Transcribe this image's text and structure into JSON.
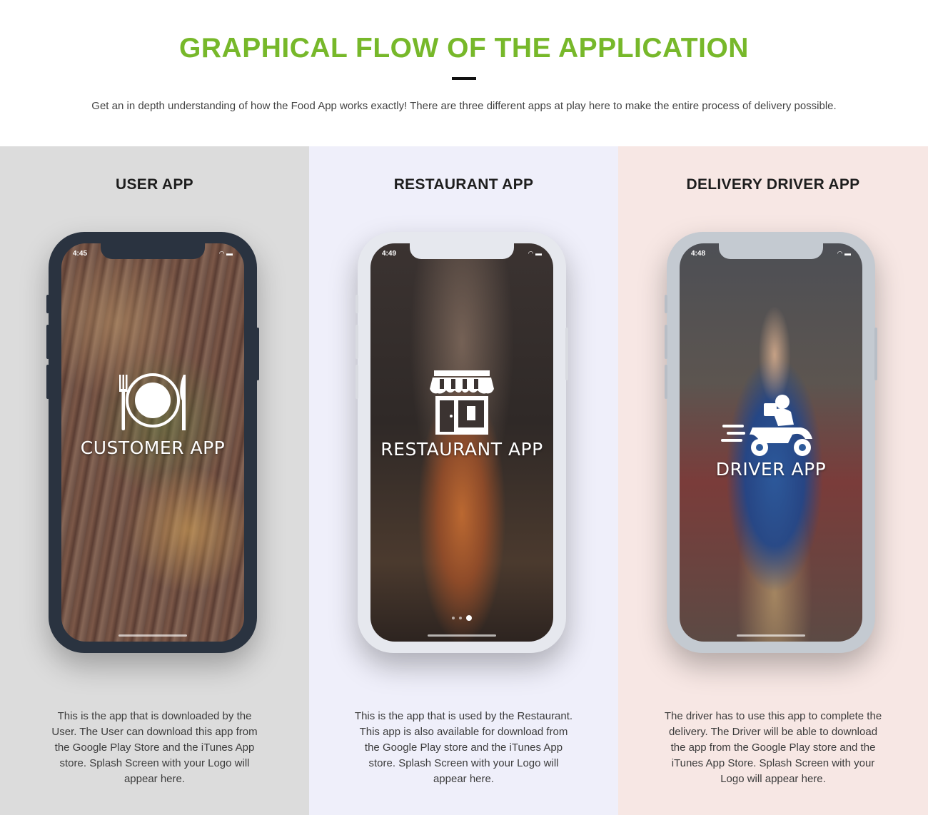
{
  "header": {
    "title": "GRAPHICAL FLOW OF THE APPLICATION",
    "subtitle": "Get an in depth understanding of how the Food App works exactly! There are three different apps at play here to make the entire process of delivery possible."
  },
  "apps": [
    {
      "heading": "USER APP",
      "status_time": "4:45",
      "screen_title": "CUSTOMER APP",
      "logo_icon": "plate-fork-knife-icon",
      "description": "This is the app that is downloaded by the User. The User can download this app from the Google Play Store and the iTunes App store. Splash Screen with your Logo will appear here."
    },
    {
      "heading": "RESTAURANT APP",
      "status_time": "4:49",
      "screen_title": "RESTAURANT APP",
      "logo_icon": "storefront-icon",
      "description": "This is the app that is used by the Restaurant. This app is also available for download from the Google Play store and the iTunes App store. Splash Screen with your Logo will appear here."
    },
    {
      "heading": "DELIVERY DRIVER APP",
      "status_time": "4:48",
      "screen_title": "DRIVER APP",
      "logo_icon": "delivery-scooter-icon",
      "description": "The driver has to use this app to complete the delivery. The Driver will be able to download the app from the Google Play store and the iTunes App Store. Splash Screen with your Logo will appear here."
    }
  ],
  "colors": {
    "title_green": "#77b82a",
    "col1_bg": "#dcdcdc",
    "col2_bg": "#efeffa",
    "col3_bg": "#f7e7e4"
  }
}
